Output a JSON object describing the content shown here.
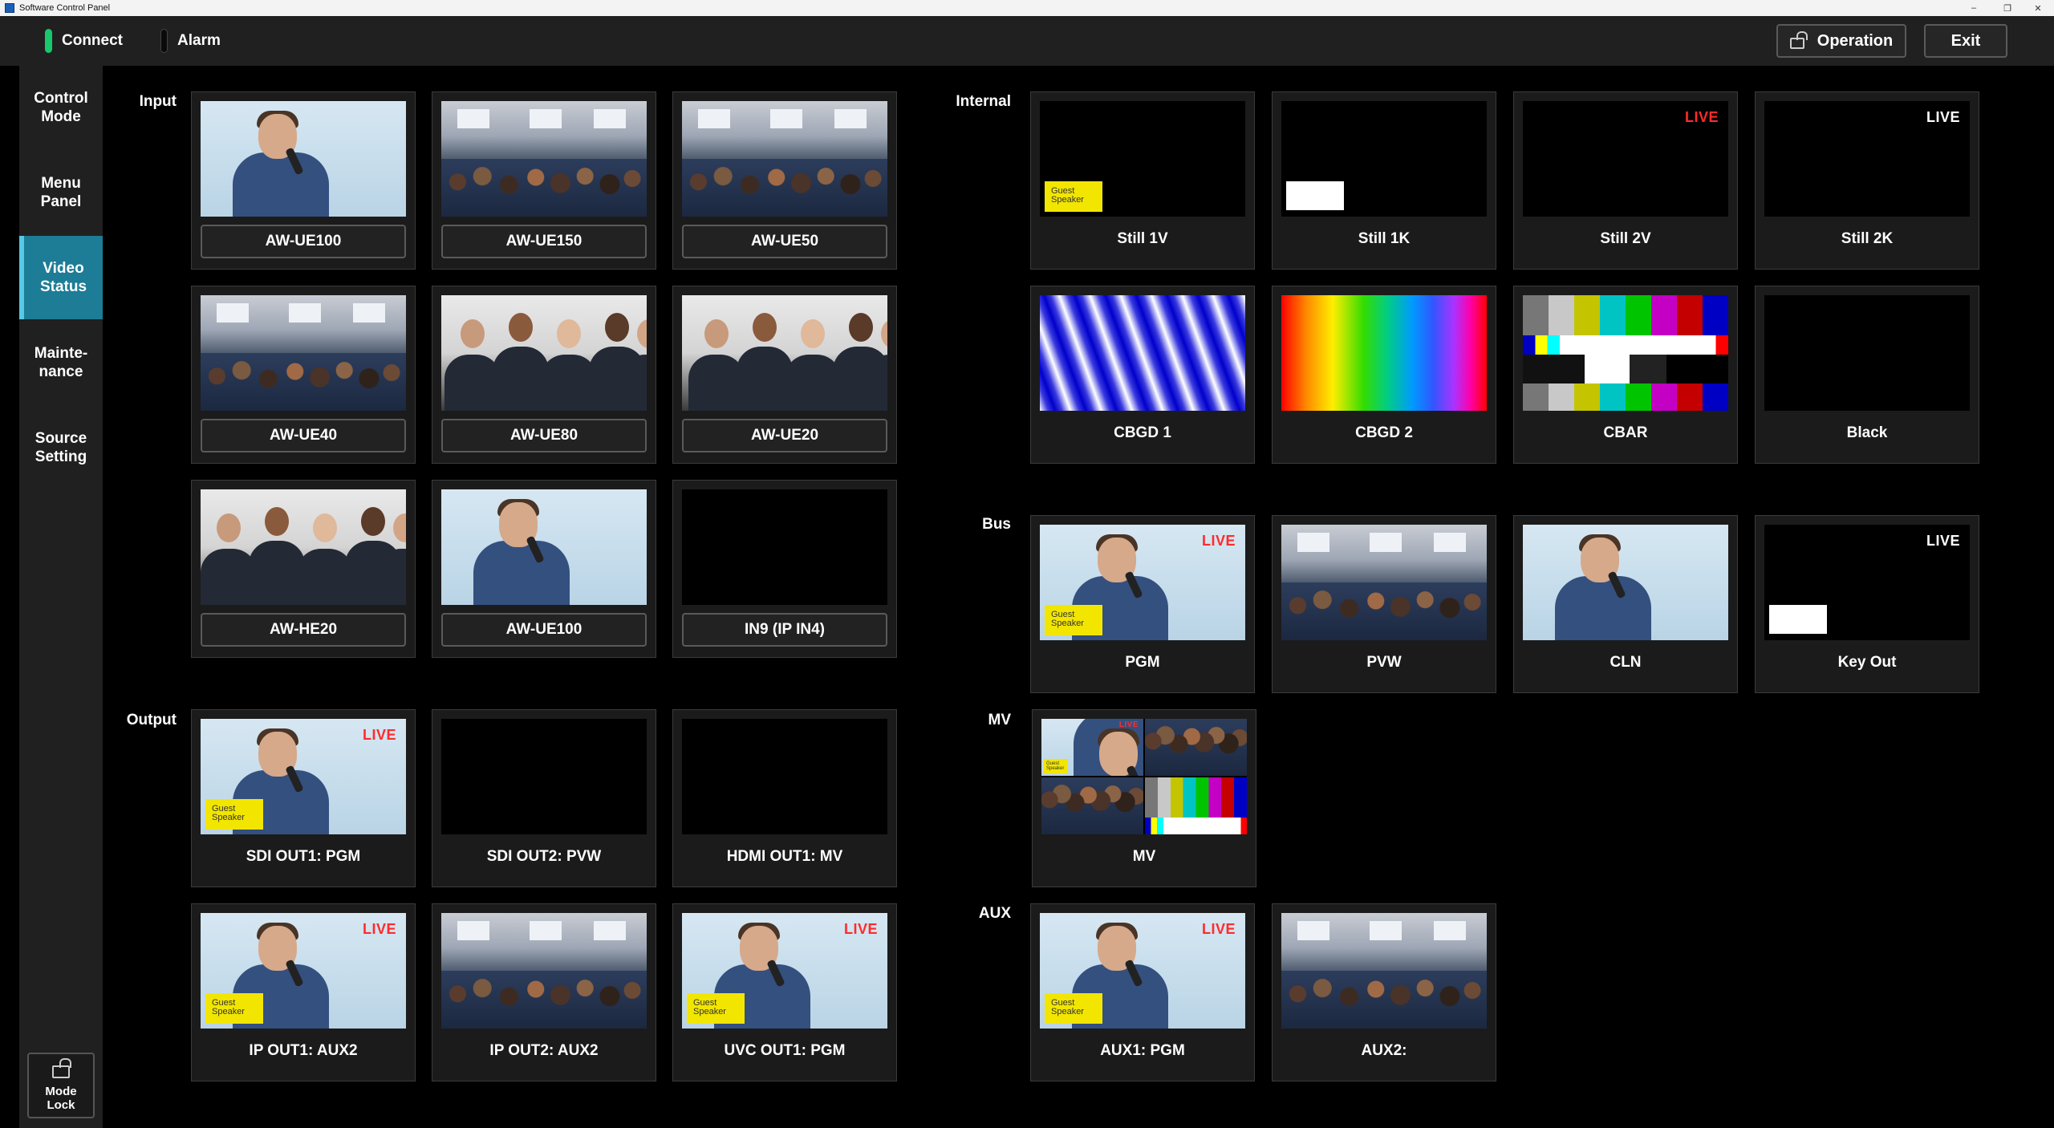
{
  "window": {
    "title": "Software Control Panel",
    "controls": [
      "–",
      "❐",
      "✕"
    ]
  },
  "topbar": {
    "connect_label": "Connect",
    "connect_color": "#18c86a",
    "alarm_label": "Alarm",
    "alarm_color": "#0a0a0a",
    "operation_label": "Operation",
    "exit_label": "Exit"
  },
  "sidebar": {
    "items": [
      {
        "label": "Control\nMode"
      },
      {
        "label": "Menu\nPanel"
      },
      {
        "label": "Video\nStatus",
        "active": true
      },
      {
        "label": "Mainte-\nnance"
      },
      {
        "label": "Source\nSetting"
      }
    ],
    "mode_lock_label": "Mode\nLock"
  },
  "sections": {
    "input": "Input",
    "output": "Output",
    "internal": "Internal",
    "bus": "Bus",
    "mv": "MV",
    "aux": "AUX"
  },
  "overlay": {
    "guest_speaker": "Guest\nSpeaker",
    "live": "LIVE"
  },
  "input_tiles": [
    {
      "label": "AW-UE100",
      "image": "speaker"
    },
    {
      "label": "AW-UE150",
      "image": "crowd"
    },
    {
      "label": "AW-UE50",
      "image": "crowd"
    },
    {
      "label": "AW-UE40",
      "image": "crowd"
    },
    {
      "label": "AW-UE80",
      "image": "people"
    },
    {
      "label": "AW-UE20",
      "image": "people"
    },
    {
      "label": "AW-HE20",
      "image": "people"
    },
    {
      "label": "AW-UE100",
      "image": "speaker"
    },
    {
      "label": "IN9 (IP IN4)",
      "image": "black"
    }
  ],
  "output_tiles": [
    {
      "label": "SDI OUT1: PGM",
      "image": "speaker",
      "live": true,
      "guest": true
    },
    {
      "label": "SDI OUT2: PVW",
      "image": "black"
    },
    {
      "label": "HDMI OUT1: MV",
      "image": "black"
    },
    {
      "label": "IP OUT1: AUX2",
      "image": "speaker",
      "live": true,
      "guest": true
    },
    {
      "label": "IP OUT2: AUX2",
      "image": "crowd"
    },
    {
      "label": "UVC OUT1: PGM",
      "image": "speaker",
      "live": true,
      "guest": true
    }
  ],
  "internal_tiles": [
    {
      "label": "Still 1V",
      "image": "black",
      "guest": true
    },
    {
      "label": "Still 1K",
      "image": "black",
      "whitebox": true
    },
    {
      "label": "Still 2V",
      "image": "black",
      "live": "red"
    },
    {
      "label": "Still 2K",
      "image": "black",
      "live": "white"
    },
    {
      "label": "CBGD 1",
      "image": "cbgd1"
    },
    {
      "label": "CBGD 2",
      "image": "cbgd2"
    },
    {
      "label": "CBAR",
      "image": "cbar"
    },
    {
      "label": "Black",
      "image": "black"
    }
  ],
  "bus_tiles": [
    {
      "label": "PGM",
      "image": "speaker",
      "live": "red",
      "guest": true
    },
    {
      "label": "PVW",
      "image": "crowd"
    },
    {
      "label": "CLN",
      "image": "speaker"
    },
    {
      "label": "Key Out",
      "image": "black",
      "live": "white",
      "whitebox": true
    }
  ],
  "mv_tiles": [
    {
      "label": "MV"
    }
  ],
  "aux_tiles": [
    {
      "label": "AUX1: PGM",
      "image": "speaker",
      "live": "red",
      "guest": true
    },
    {
      "label": "AUX2:",
      "image": "crowd"
    }
  ]
}
